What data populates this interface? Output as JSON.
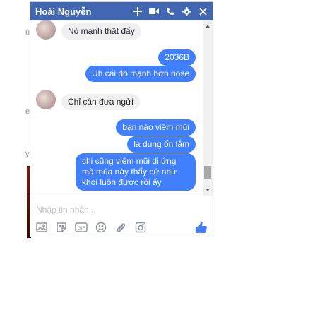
{
  "chat": {
    "title": "Hoài Nguyễn",
    "header_icons": [
      "plus-icon",
      "video-icon",
      "phone-icon",
      "gear-icon",
      "close-icon"
    ]
  },
  "messages": [
    {
      "side": "in",
      "text": "Nó mạnh thật đấy",
      "avatar": true
    },
    {
      "side": "out",
      "text": "2036B"
    },
    {
      "side": "out",
      "text": "Uh cái đó mạnh hơn nose"
    },
    {
      "side": "in",
      "text": "Chỉ cần đưa ngửi",
      "avatar": true
    },
    {
      "side": "out",
      "text": "bạn nào viêm mũi"
    },
    {
      "side": "out",
      "text": "là dùng ổn lắm"
    },
    {
      "side": "out",
      "text": "chị cũng viêm mũi dị ứng mà mùa này thấy cứ như khỏi luôn được rồi ấy"
    }
  ],
  "composer": {
    "placeholder": "Nhập tin nhắn...",
    "tools": [
      "photo-icon",
      "sticker-icon",
      "gif-icon",
      "emoji-icon",
      "attach-icon",
      "camera-icon"
    ],
    "like": "thumbs-up-icon"
  },
  "colors": {
    "header": "#4267b2",
    "outgoing": "#4080ff",
    "incoming": "#f1f0f0"
  },
  "background_fragments": [
    "ú",
    "e",
    "y"
  ]
}
